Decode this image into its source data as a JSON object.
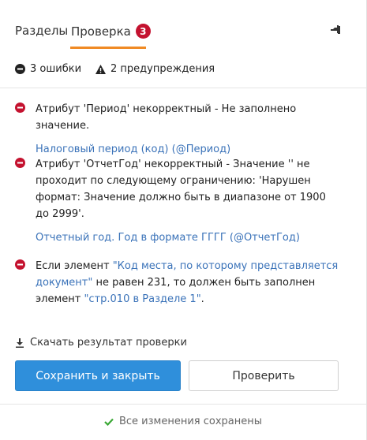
{
  "tabs": {
    "sections_label": "Разделы",
    "check_label": "Проверка",
    "check_badge": "3"
  },
  "summary": {
    "errors": "3 ошибки",
    "warnings": "2 предупреждения"
  },
  "errors": [
    {
      "text": "Атрибут 'Период' некорректный - Не заполнено значение.",
      "link": "Налоговый период (код) (@Период)"
    },
    {
      "text": "Атрибут 'ОтчетГод' некорректный - Значение '' не проходит по следующему ограничению: 'Нарушен формат: Значение должно быть в диапазоне от 1900 до 2999'.",
      "link": "Отчетный год. Год в формате ГГГГ (@ОтчетГод)"
    },
    {
      "part1": "Если элемент ",
      "link1": "\"Код места, по которому представляется документ\"",
      "part2": " не равен 231, то должен быть заполнен элемент ",
      "link2": "\"стр.010 в Разделе 1\"",
      "part3": "."
    }
  ],
  "download_label": "Скачать результат проверки",
  "buttons": {
    "save_close": "Сохранить и закрыть",
    "check": "Проверить"
  },
  "footer": {
    "status": "Все изменения сохранены"
  },
  "colors": {
    "accent_tab": "#f08a24",
    "badge": "#c4122f",
    "error_icon": "#c4122f",
    "link": "#3b73b9",
    "primary_button": "#2f8fdb",
    "success_check": "#3aa835"
  }
}
